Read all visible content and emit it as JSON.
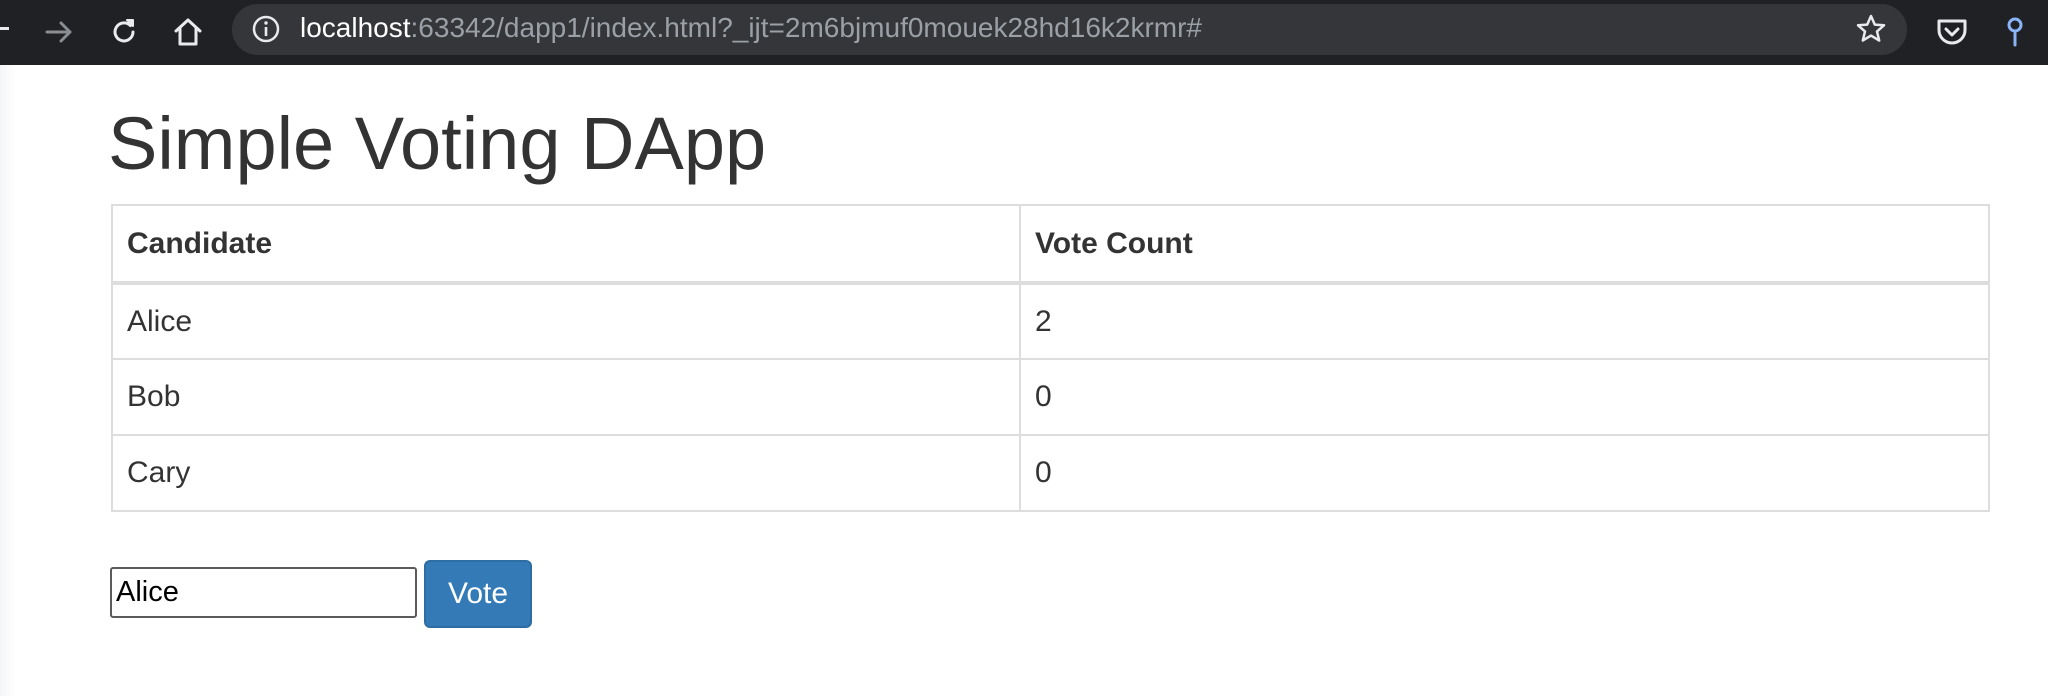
{
  "browser": {
    "url_host": "localhost",
    "url_rest": ":63342/dapp1/index.html?_ijt=2m6bjmuf0mouek28hd16k2krmr#",
    "icons": [
      "back-icon",
      "forward-icon",
      "reload-icon",
      "home-icon",
      "info-icon",
      "bookmark-star-icon",
      "pocket-icon",
      "key-icon"
    ],
    "colors": {
      "chrome": "#202124",
      "urlbar": "#35363a",
      "accent": "#8ab4f8"
    }
  },
  "page": {
    "title": "Simple Voting DApp",
    "table": {
      "headers": [
        "Candidate",
        "Vote Count"
      ],
      "rows": [
        {
          "candidate": "Alice",
          "votes": "2"
        },
        {
          "candidate": "Bob",
          "votes": "0"
        },
        {
          "candidate": "Cary",
          "votes": "0"
        }
      ]
    },
    "form": {
      "input_value": "Alice",
      "button_label": "Vote"
    },
    "colors": {
      "button": "#337ab7",
      "text": "#333333",
      "border": "#dddddd"
    }
  }
}
